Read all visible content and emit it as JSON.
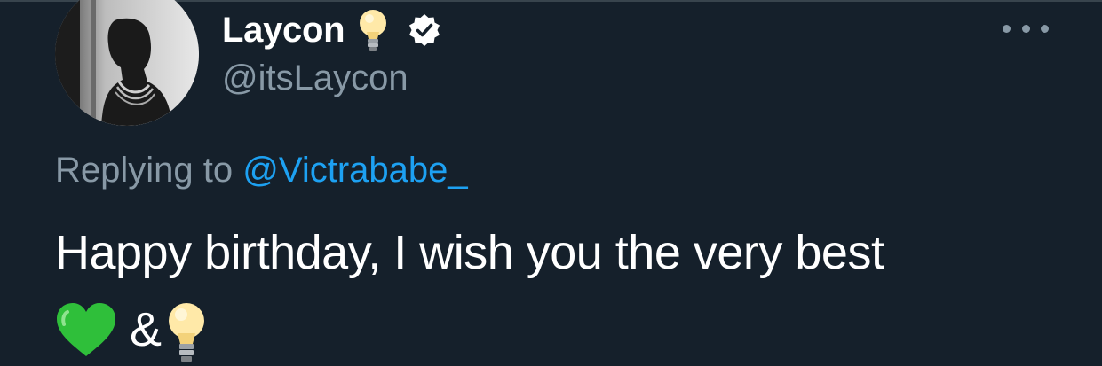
{
  "author": {
    "display_name": "Laycon",
    "handle": "@itsLaycon",
    "name_emoji": "light-bulb-icon",
    "verified": true
  },
  "reply_context": {
    "prefix": "Replying to",
    "mention": "@Victrababe_"
  },
  "tweet": {
    "text": "Happy birthday, I wish you the very best",
    "emojis": [
      "green-heart-icon",
      "light-bulb-icon"
    ],
    "separator": "&"
  },
  "colors": {
    "background": "#15202b",
    "primary_text": "#ffffff",
    "secondary_text": "#8899a6",
    "link": "#1da1f2"
  }
}
